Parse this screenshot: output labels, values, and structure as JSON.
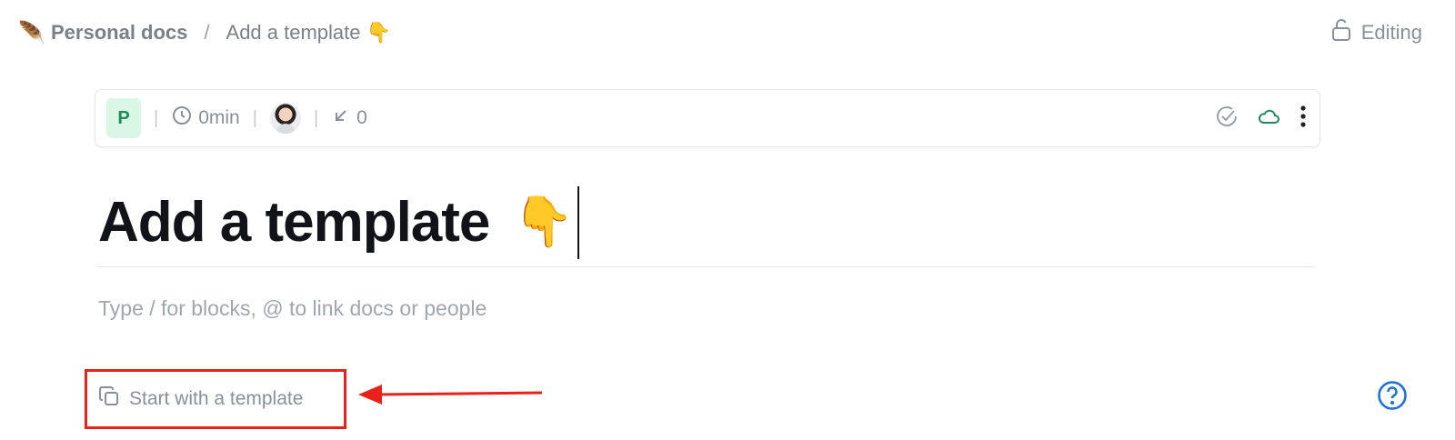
{
  "breadcrumb": {
    "workspace_icon": "🪶",
    "space": "Personal docs",
    "separator": "/",
    "doc": "Add a template 👇"
  },
  "header": {
    "status_icon": "unlock-icon",
    "status_label": "Editing"
  },
  "meta": {
    "badge_letter": "P",
    "read_time": "0min",
    "backlinks_count": "0",
    "icons": [
      "clock-icon",
      "avatar",
      "backlink-icon",
      "check-circle-icon",
      "cloud-icon",
      "more-vertical-icon"
    ]
  },
  "doc": {
    "title": "Add a template",
    "title_emoji": "👇",
    "placeholder": "Type / for blocks, @ to link docs or people"
  },
  "template_button": {
    "icon": "copy-icon",
    "label": "Start with a template"
  },
  "colors": {
    "accent_green": "#1f8a53",
    "badge_bg": "#d9f6e6",
    "highlight_red": "#e8221b",
    "help_blue": "#1a73d9"
  }
}
